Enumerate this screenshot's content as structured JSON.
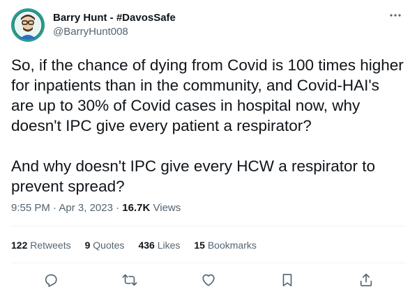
{
  "author": {
    "display_name": "Barry Hunt - #DavosSafe",
    "handle": "@BarryHunt008"
  },
  "tweet": {
    "text": "So, if the chance of dying from Covid is 100 times higher for inpatients than in the community, and Covid-HAI's are up to 30% of Covid cases in hospital now, why doesn't IPC give every patient a respirator?\n\nAnd why doesn't IPC give every HCW a respirator to prevent spread?",
    "time": "9:55 PM",
    "separator": " · ",
    "date": "Apr 3, 2023",
    "views_count": "16.7K",
    "views_label": "Views"
  },
  "stats": [
    {
      "count": "122",
      "label": "Retweets"
    },
    {
      "count": "9",
      "label": "Quotes"
    },
    {
      "count": "436",
      "label": "Likes"
    },
    {
      "count": "15",
      "label": "Bookmarks"
    }
  ],
  "icons": {
    "more": "more-icon",
    "reply": "reply-icon",
    "retweet": "retweet-icon",
    "like": "like-icon",
    "bookmark": "bookmark-icon",
    "share": "share-icon"
  },
  "colors": {
    "text": "#0f1419",
    "secondary": "#536471",
    "divider": "#eff3f4",
    "avatar_bg": "#2a9d8f"
  }
}
